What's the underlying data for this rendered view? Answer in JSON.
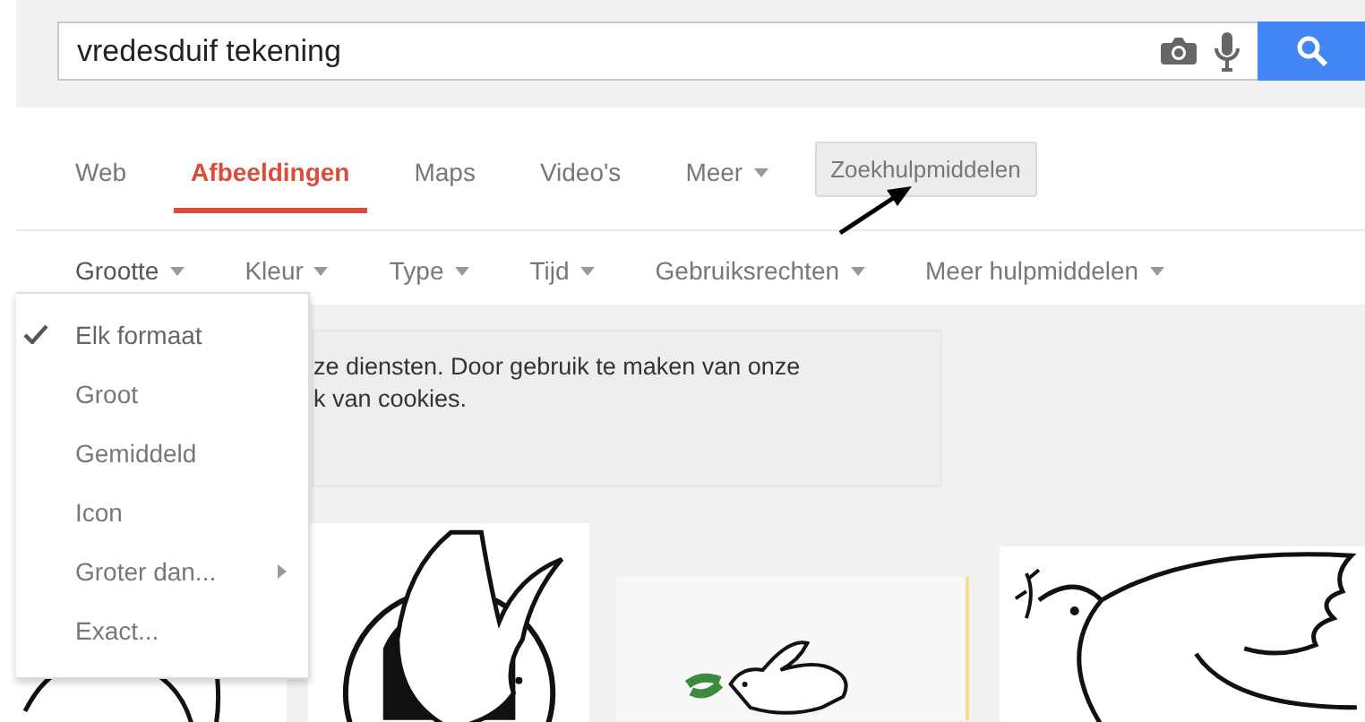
{
  "search": {
    "query": "vredesduif tekening"
  },
  "tabs": [
    {
      "label": "Web",
      "selected": false,
      "has_caret": false
    },
    {
      "label": "Afbeeldingen",
      "selected": true,
      "has_caret": false
    },
    {
      "label": "Maps",
      "selected": false,
      "has_caret": false
    },
    {
      "label": "Video's",
      "selected": false,
      "has_caret": false
    },
    {
      "label": "Meer",
      "selected": false,
      "has_caret": true
    }
  ],
  "tools_button": {
    "label": "Zoekhulpmiddelen",
    "pressed": true
  },
  "tools": [
    {
      "label": "Grootte",
      "open": true
    },
    {
      "label": "Kleur",
      "open": false
    },
    {
      "label": "Type",
      "open": false
    },
    {
      "label": "Tijd",
      "open": false
    },
    {
      "label": "Gebruiksrechten",
      "open": false
    },
    {
      "label": "Meer hulpmiddelen",
      "open": false
    }
  ],
  "size_menu": [
    {
      "label": "Elk formaat",
      "selected": true,
      "has_submenu": false
    },
    {
      "label": "Groot",
      "selected": false,
      "has_submenu": false
    },
    {
      "label": "Gemiddeld",
      "selected": false,
      "has_submenu": false
    },
    {
      "label": "Icon",
      "selected": false,
      "has_submenu": false
    },
    {
      "label": "Groter dan...",
      "selected": false,
      "has_submenu": true
    },
    {
      "label": "Exact...",
      "selected": false,
      "has_submenu": false
    }
  ],
  "cookie_notice": {
    "lines": [
      "ze diensten. Door gebruik te maken van onze",
      "k van cookies."
    ]
  }
}
